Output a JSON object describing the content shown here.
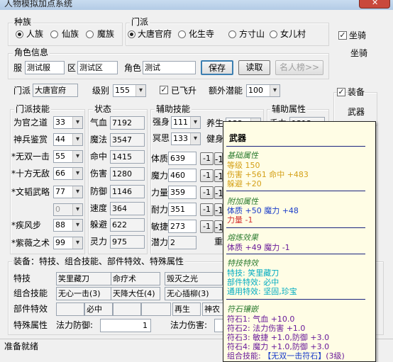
{
  "window": {
    "title": "人物模拟加点系统"
  },
  "race": {
    "label": "种族",
    "options": [
      "人族",
      "仙族",
      "魔族"
    ],
    "selected": 0
  },
  "sect": {
    "label": "门派",
    "options": [
      "大唐官府",
      "化生寺",
      "方寸山",
      "女儿村"
    ],
    "selected": 0
  },
  "mount": {
    "checkbox_label": "坐骑",
    "button_label": "坐骑"
  },
  "info": {
    "label": "角色信息",
    "server_label": "服",
    "server_value": "测试服",
    "zone_label": "区",
    "zone_value": "测试区",
    "role_label": "角色",
    "role_value": "测试",
    "save": "保存",
    "load": "读取",
    "rank": "名人榜>>"
  },
  "row2": {
    "sect_label": "门派",
    "sect_value": "大唐官府",
    "level_label": "级别",
    "level_value": "155",
    "flown_label": "已飞升",
    "extra_label": "额外潜能",
    "extra_value": "100"
  },
  "equip_side": {
    "checkbox_label": "装备",
    "button_label": "武器"
  },
  "skills": {
    "label": "门派技能",
    "items": [
      {
        "name": "为官之道",
        "value": "33"
      },
      {
        "name": "神兵鉴赏",
        "value": "44"
      },
      {
        "name": "*无双一击",
        "value": "55"
      },
      {
        "name": "*十方无敌",
        "value": "66"
      },
      {
        "name": "*文韬武略",
        "value": "77"
      },
      {
        "name": "",
        "value": "0"
      },
      {
        "name": "*疾风步",
        "value": "88"
      },
      {
        "name": "*紫薇之术",
        "value": "99"
      }
    ]
  },
  "stats": {
    "label": "状态",
    "items": [
      {
        "name": "气血",
        "value": "7192"
      },
      {
        "name": "魔法",
        "value": "3547"
      },
      {
        "name": "命中",
        "value": "1415"
      },
      {
        "name": "伤害",
        "value": "1280"
      },
      {
        "name": "防御",
        "value": "1146"
      },
      {
        "name": "速度",
        "value": "364"
      },
      {
        "name": "躲避",
        "value": "622"
      },
      {
        "name": "灵力",
        "value": "975"
      }
    ]
  },
  "aux": {
    "label": "辅助技能",
    "items": [
      {
        "name": "强身",
        "value": "111"
      },
      {
        "name": "冥思",
        "value": "133"
      }
    ],
    "right_items": [
      "养生",
      "健身"
    ],
    "right_value": "122"
  },
  "attrs": {
    "items": [
      {
        "name": "体质",
        "value": "639"
      },
      {
        "name": "魔力",
        "value": "460"
      },
      {
        "name": "力量",
        "value": "359"
      },
      {
        "name": "耐力",
        "value": "351"
      },
      {
        "name": "敏捷",
        "value": "273"
      }
    ],
    "potential_label": "潜力",
    "potential_value": "2",
    "minus": "-1",
    "reset": "重"
  },
  "aux_attr": {
    "label": "辅助属性",
    "first_label": "手力",
    "first_value": "1313"
  },
  "bottom": {
    "label": "装备：特技、组合技能、部件特效、特殊属性",
    "special_label": "特技",
    "specials": [
      "笑里藏刀",
      "命疗术",
      "毁灭之光"
    ],
    "combo_label": "组合技能",
    "combos": [
      "无心一击(3)",
      "天降大任(4)",
      "无心插柳(3)"
    ],
    "part_label": "部件特效",
    "part_value": "必中",
    "part_value2": "再生",
    "part_value3": "神农",
    "attr_label": "特殊属性",
    "mdef_label": "法力防御:",
    "mdef_value": "1",
    "mdmg_label": "法力伤害:"
  },
  "status": {
    "text": "准备就绪"
  },
  "tooltip": {
    "title": "武器",
    "base_label": "基础属性",
    "level": "等级  150",
    "damage": "伤害 +561  命中 +483",
    "dodge": "躲避 +20",
    "add_label": "附加属性",
    "add1": "体质 +50      魔力 +48",
    "add2": "力量 -1",
    "forge_label": "熔炼效果",
    "forge": "体质 +49      魔力 -1",
    "special_label": "特技特效",
    "special_skill": "特技: 笑里藏刀",
    "part_effect": "部件特效: 必中",
    "general_effect": "通用特效: 坚固,珍宝",
    "rune_label": "符石镶嵌",
    "runes": [
      "符石1: 气血 +10.0",
      "符石2: 法力伤害 +1.0",
      "符石3: 敏捷 +1.0,防御 +3.0",
      "符石4: 魔力 +1.0,防御 +3.0"
    ],
    "combo_prefix": "组合技能: ",
    "combo_name": "【无双一击符石】",
    "combo_level": "(3级)"
  },
  "colors": {
    "tooltip_bg": "#fffde5",
    "section_title": "#2e7d32",
    "gold": "#d4a017",
    "red": "#d32f2f",
    "blue": "#1a3cc9",
    "cyan": "#00acc1",
    "purple": "#6a1b9a"
  }
}
